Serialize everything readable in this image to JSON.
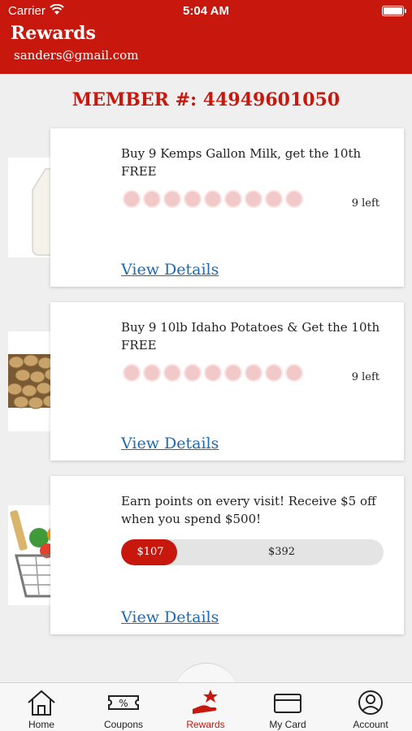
{
  "status_bar": {
    "carrier": "Carrier",
    "time": "5:04 AM"
  },
  "header": {
    "title": "Rewards",
    "email": "sanders@gmail.com"
  },
  "member": {
    "text": "MEMBER #: 44949601050"
  },
  "rewards": [
    {
      "image": "milk-gallon",
      "title": "Buy 9 Kemps Gallon Milk, get the 10th FREE",
      "punches_total": 9,
      "punches_filled": 0,
      "remaining": "9 left",
      "link": "View Details"
    },
    {
      "image": "potatoes",
      "title": "Buy 9 10lb Idaho Potatoes & Get the 10th FREE",
      "punches_total": 9,
      "punches_filled": 0,
      "remaining": "9 left",
      "link": "View Details"
    },
    {
      "image": "grocery-basket",
      "title": "Earn points on every visit! Receive $5 off when you spend $500!",
      "earned": "$107",
      "remaining_amount": "$392",
      "progress_percent": 21.4,
      "link": "View Details"
    }
  ],
  "tabs": [
    {
      "label": "Home",
      "icon": "home-icon"
    },
    {
      "label": "Coupons",
      "icon": "coupon-icon"
    },
    {
      "label": "Rewards",
      "icon": "rewards-icon",
      "active": true
    },
    {
      "label": "My Card",
      "icon": "card-icon"
    },
    {
      "label": "Account",
      "icon": "account-icon"
    }
  ],
  "colors": {
    "brand_red": "#c8170d",
    "link_blue": "#1d6ab1",
    "punch": "#f2c9c9"
  }
}
